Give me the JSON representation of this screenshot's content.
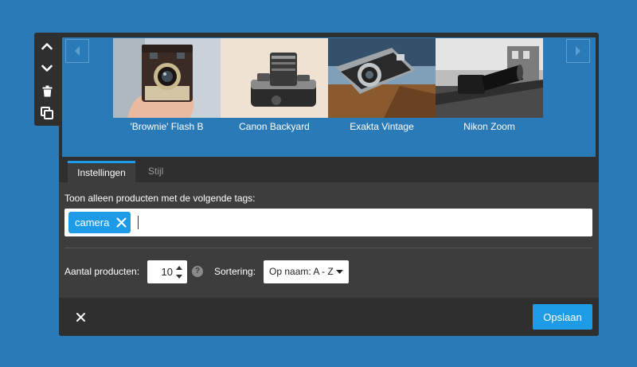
{
  "toolbar": {
    "icons": [
      "chevron-up-icon",
      "chevron-down-icon",
      "trash-icon",
      "copy-icon"
    ]
  },
  "preview": {
    "products": [
      {
        "name": "'Brownie' Flash B"
      },
      {
        "name": "Canon Backyard"
      },
      {
        "name": "Exakta Vintage"
      },
      {
        "name": "Nikon Zoom"
      }
    ]
  },
  "tabs": [
    {
      "label": "Instellingen",
      "active": true
    },
    {
      "label": "Stijl",
      "active": false
    }
  ],
  "settings": {
    "tags_label": "Toon alleen producten met de volgende tags:",
    "tags": [
      {
        "label": "camera"
      }
    ],
    "count_label": "Aantal producten:",
    "count_value": "10",
    "help_glyph": "?",
    "sort_label": "Sortering:",
    "sort_value": "Op naam: A - Z"
  },
  "footer": {
    "save_label": "Opslaan"
  },
  "colors": {
    "page_bg": "#2b7ab8",
    "panel_bg": "#2f2f2f",
    "settings_bg": "#3d3d3d",
    "accent": "#1e9be6"
  }
}
